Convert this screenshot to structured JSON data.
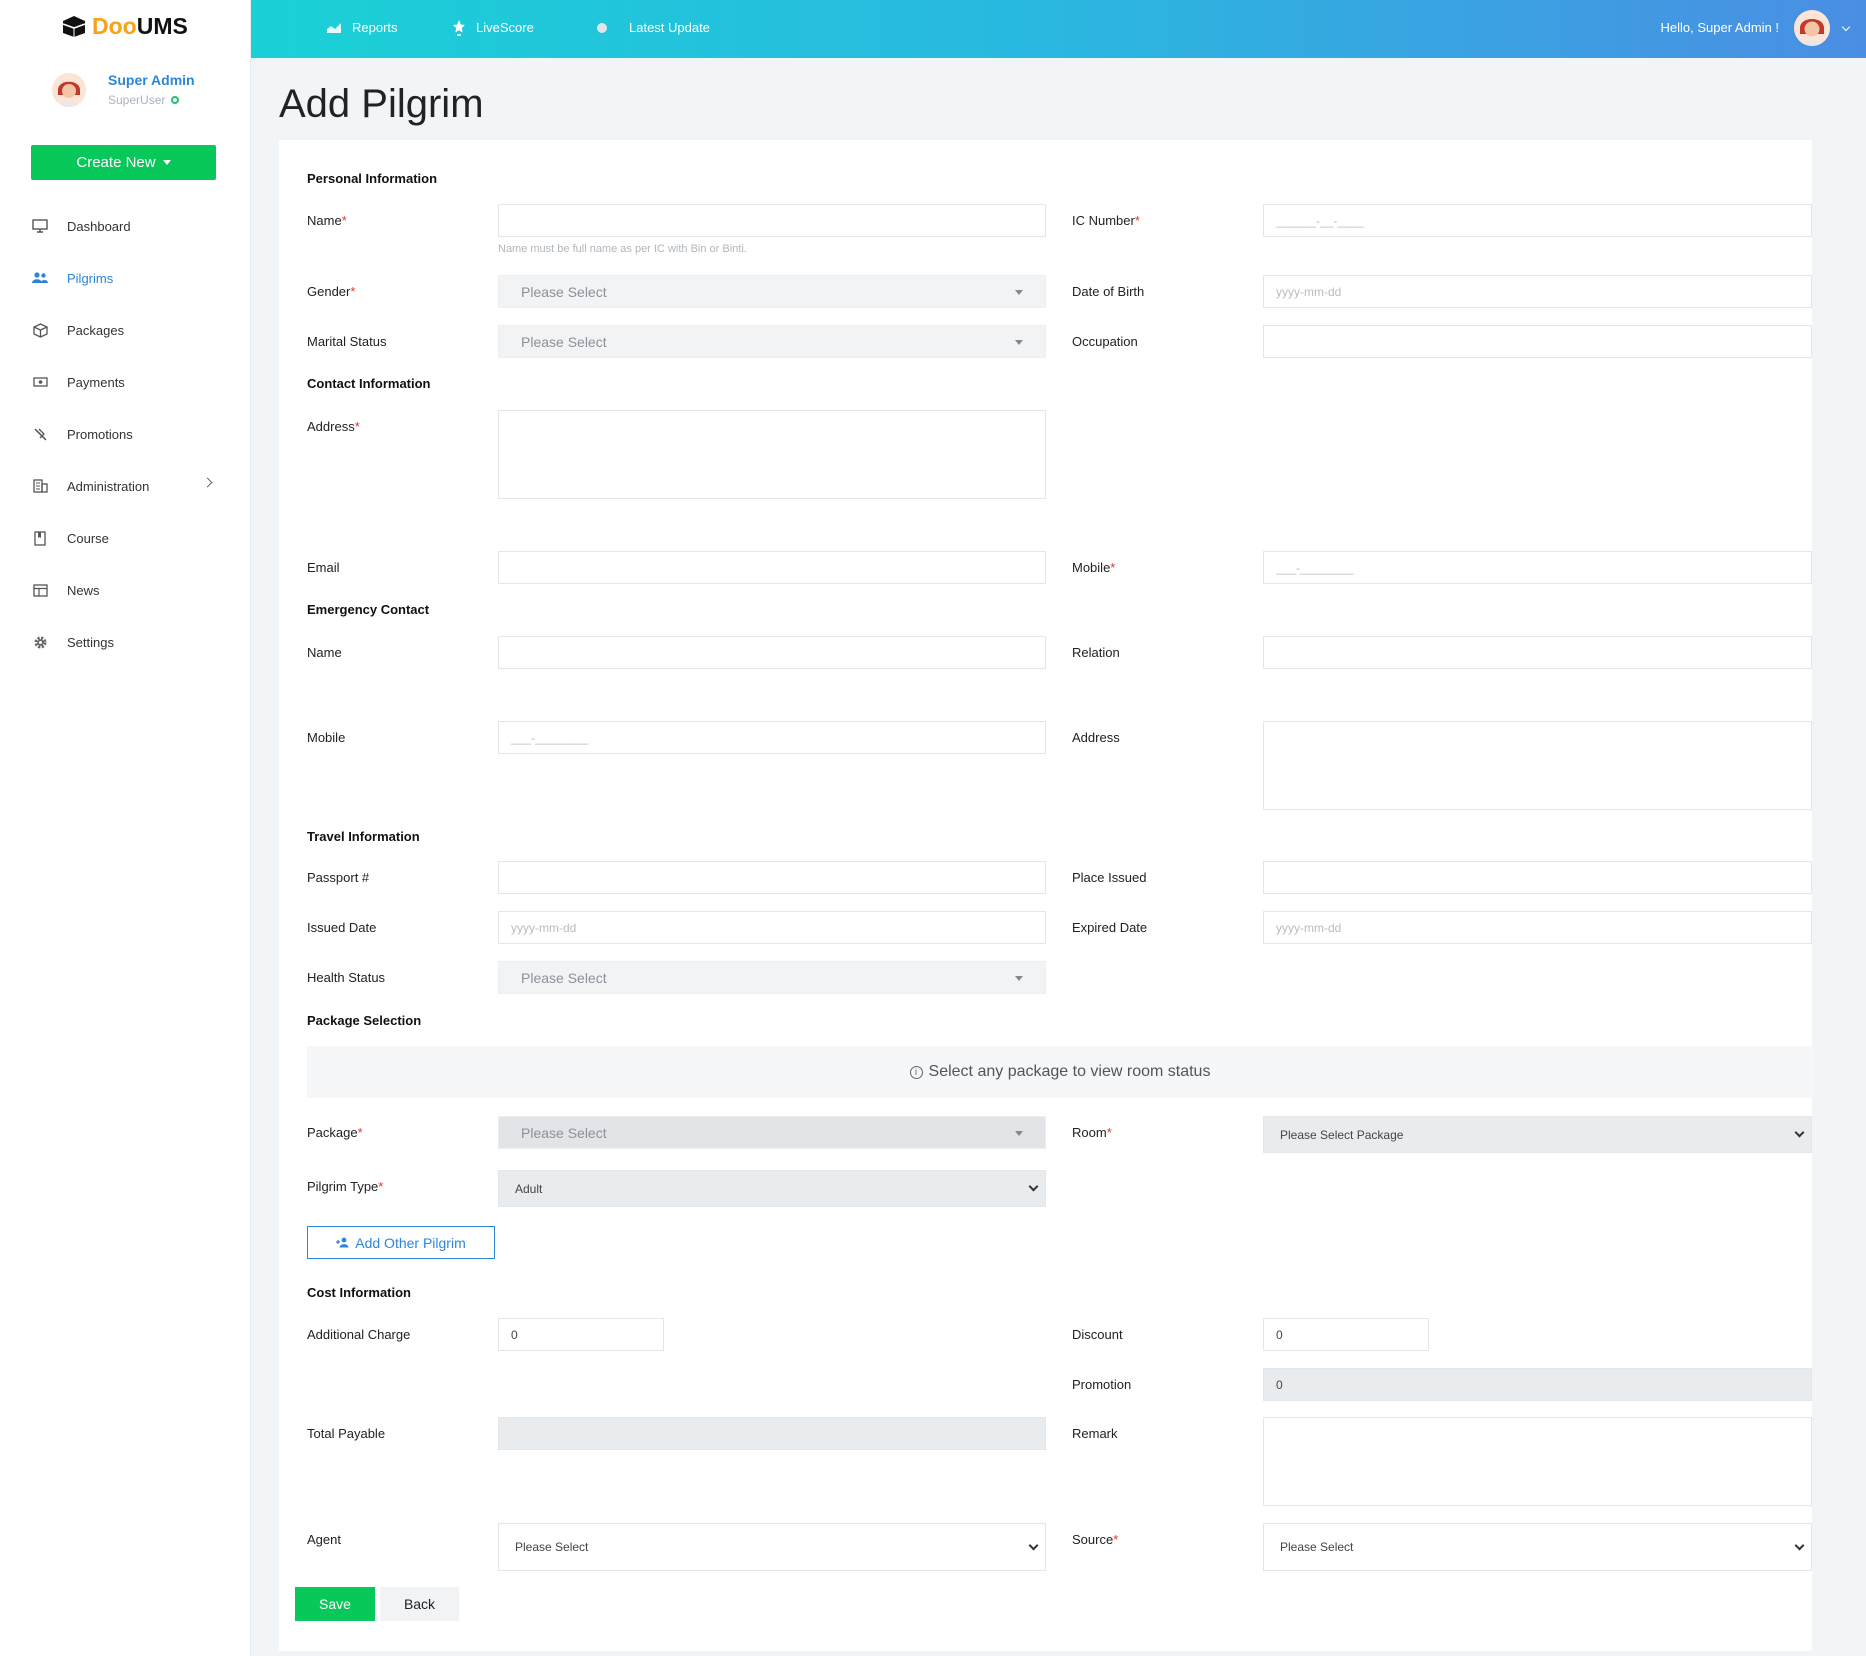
{
  "brand": {
    "part1": "Doo",
    "part2": "UMS"
  },
  "user": {
    "name": "Super Admin",
    "role": "SuperUser"
  },
  "sidebar": {
    "create_label": "Create New",
    "items": [
      {
        "label": "Dashboard",
        "icon": "monitor-icon"
      },
      {
        "label": "Pilgrims",
        "icon": "users-icon"
      },
      {
        "label": "Packages",
        "icon": "box-icon"
      },
      {
        "label": "Payments",
        "icon": "cash-icon"
      },
      {
        "label": "Promotions",
        "icon": "tag-slash-icon"
      },
      {
        "label": "Administration",
        "icon": "building-icon"
      },
      {
        "label": "Course",
        "icon": "book-icon"
      },
      {
        "label": "News",
        "icon": "newspaper-icon"
      },
      {
        "label": "Settings",
        "icon": "gear-icon"
      }
    ]
  },
  "topbar": {
    "links": [
      "Reports",
      "LiveScore",
      "Latest Update"
    ],
    "greeting": "Hello, Super Admin !"
  },
  "page": {
    "title": "Add Pilgrim"
  },
  "form": {
    "personal": {
      "title": "Personal Information",
      "name_label": "Name",
      "name_hint": "Name must be full name as per IC with Bin or Binti.",
      "ic_label": "IC Number",
      "ic_placeholder": "______-__-____",
      "gender_label": "Gender",
      "gender_value": "Please Select",
      "dob_label": "Date of Birth",
      "dob_placeholder": "yyyy-mm-dd",
      "marital_label": "Marital Status",
      "marital_value": "Please Select",
      "occupation_label": "Occupation"
    },
    "contact": {
      "title": "Contact Information",
      "address_label": "Address",
      "email_label": "Email",
      "mobile_label": "Mobile",
      "mobile_placeholder": "___-________"
    },
    "emergency": {
      "title": "Emergency Contact",
      "name_label": "Name",
      "relation_label": "Relation",
      "mobile_label": "Mobile",
      "mobile_placeholder": "___-________",
      "address_label": "Address"
    },
    "travel": {
      "title": "Travel Information",
      "passport_label": "Passport #",
      "place_label": "Place Issued",
      "issued_label": "Issued Date",
      "issued_placeholder": "yyyy-mm-dd",
      "expired_label": "Expired Date",
      "expired_placeholder": "yyyy-mm-dd",
      "health_label": "Health Status",
      "health_value": "Please Select"
    },
    "package": {
      "title": "Package Selection",
      "notice": "Select any package to view room status",
      "package_label": "Package",
      "package_value": "Please Select",
      "room_label": "Room",
      "room_value": "Please Select Package",
      "type_label": "Pilgrim Type",
      "type_value": "Adult",
      "add_other_label": "Add Other Pilgrim"
    },
    "cost": {
      "title": "Cost Information",
      "additional_label": "Additional Charge",
      "additional_value": "0",
      "discount_label": "Discount",
      "discount_value": "0",
      "promotion_label": "Promotion",
      "promotion_value": "0",
      "total_label": "Total Payable",
      "remark_label": "Remark",
      "agent_label": "Agent",
      "agent_value": "Please Select",
      "source_label": "Source",
      "source_value": "Please Select"
    },
    "save_label": "Save",
    "back_label": "Back"
  }
}
